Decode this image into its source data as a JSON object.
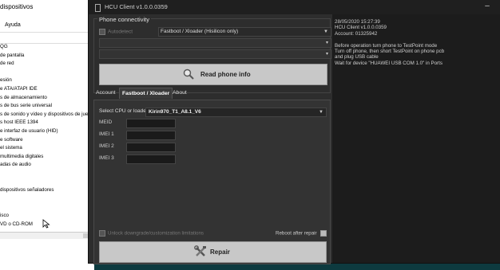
{
  "devmgr": {
    "title": "dispositivos",
    "menu_help": "Ayuda",
    "items": [
      "QG",
      "de pantalla",
      "de red",
      "",
      "esión",
      "e ATA/ATAPI IDE",
      "s de almacenamiento",
      "s de bus serie universal",
      "s de sonido y vídeo y dispositivos de jue",
      "s host IEEE 1394",
      "e interfaz de usuario (HID)",
      "e software",
      "el sistema",
      "multimedia digitales",
      "adas de audio",
      "",
      "",
      "dispositivos señaladores",
      "",
      "",
      "isco",
      "VD o CD-ROM"
    ]
  },
  "app": {
    "title": "HCU Client   v1.0.0.0359",
    "phone_connectivity": {
      "legend": "Phone connectivity",
      "autodetect_label": "Autodetect",
      "mode_value": "Fastboot / Xloader (Hisilicon only)",
      "read_button": "Read phone info"
    },
    "tabs": [
      "Account",
      "Fastboot / Xloader",
      "About"
    ],
    "active_tab": "Fastboot / Xloader",
    "fastboot": {
      "cpu_label": "Select CPU or loader",
      "cpu_value": "Kirin970_T1_A8.1_V6",
      "fields": [
        {
          "label": "MEID",
          "value": ""
        },
        {
          "label": "IMEI 1",
          "value": ""
        },
        {
          "label": "IMEI 2",
          "value": ""
        },
        {
          "label": "IMEI 3",
          "value": ""
        }
      ],
      "unlock_label": "Unlock downgrade/customization limitations",
      "reboot_label": "Reboot after repair",
      "repair_button": "Repair"
    },
    "log": [
      "28/05/2020 15:27:39",
      "HCU Client   v1.0.0.0359",
      "Account: 01325942",
      "",
      "Before operation turn phone to TestPoint mode",
      "Turn off phone, then short TestPoint on phone pcb",
      "and plug USB cable",
      "Wait for device \"HUAWEI USB COM 1.0\" in Ports"
    ]
  },
  "colors": {
    "app_bg": "#2b2b2b",
    "log_bg": "#1c1c1c",
    "button_bg": "#c8c8c8",
    "desktop_bg": "#0d3a3f"
  }
}
